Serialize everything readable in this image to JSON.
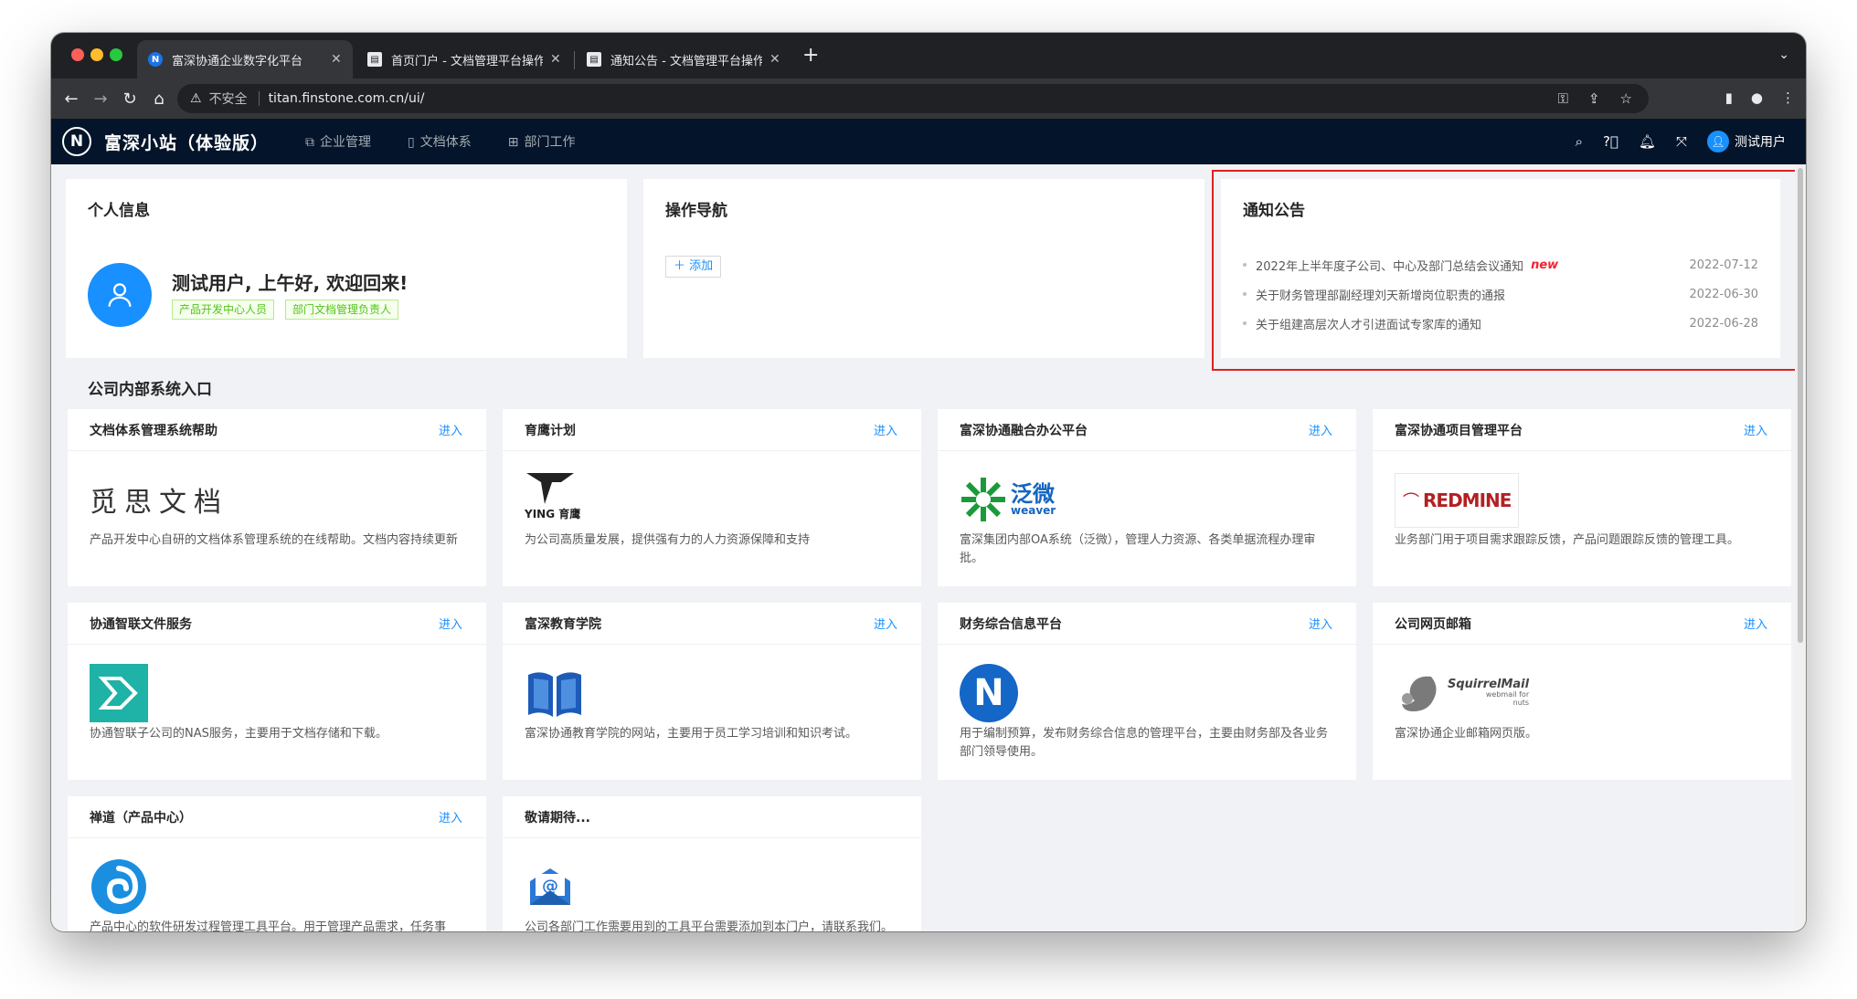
{
  "browser": {
    "tabs": [
      {
        "title": "富深协通企业数字化平台",
        "favicon": "N",
        "active": true
      },
      {
        "title": "首页门户 - 文档管理平台操作指南",
        "favicon": "doc",
        "active": false
      },
      {
        "title": "通知公告 - 文档管理平台操作指南",
        "favicon": "doc",
        "active": false
      }
    ],
    "address": {
      "security_label": "不安全",
      "url": "titan.finstone.com.cn/ui/"
    }
  },
  "app": {
    "logo_letter": "N",
    "title": "富深小站（体验版）",
    "nav": [
      {
        "label": "企业管理",
        "icon": "cluster-icon"
      },
      {
        "label": "文档体系",
        "icon": "file-icon"
      },
      {
        "label": "部门工作",
        "icon": "appstore-icon"
      }
    ],
    "user_name": "测试用户"
  },
  "profile": {
    "title": "个人信息",
    "greeting": "测试用户, 上午好, 欢迎回来!",
    "tags": [
      "产品开发中心人员",
      "部门文档管理负责人"
    ]
  },
  "operations": {
    "title": "操作导航",
    "add_label": "添加"
  },
  "notices": {
    "title": "通知公告",
    "items": [
      {
        "text": "2022年上半年度子公司、中心及部门总结会议通知",
        "badge": "new",
        "date": "2022-07-12"
      },
      {
        "text": "关于财务管理部副经理刘天新增岗位职责的通报",
        "badge": "",
        "date": "2022-06-30"
      },
      {
        "text": "关于组建高层次人才引进面试专家库的通知",
        "badge": "",
        "date": "2022-06-28"
      }
    ]
  },
  "systems": {
    "title": "公司内部系统入口",
    "enter_label": "进入",
    "items": [
      {
        "name": "文档体系管理系统帮助",
        "logo_text": "觅思文档",
        "desc": "产品开发中心自研的文档体系管理系统的在线帮助。文档内容持续更新"
      },
      {
        "name": "育鹰计划",
        "logo_text": "YING 育鹰",
        "desc": "为公司高质量发展，提供强有力的人力资源保障和支持"
      },
      {
        "name": "富深协通融合办公平台",
        "logo_text": "泛微",
        "logo_sub": "weaver",
        "desc": "富深集团内部OA系统（泛微），管理人力资源、各类单据流程办理审批。"
      },
      {
        "name": "富深协通项目管理平台",
        "logo_text": "REDMINE",
        "desc": "业务部门用于项目需求跟踪反馈，产品问题跟踪反馈的管理工具。"
      },
      {
        "name": "协通智联文件服务",
        "logo_text": "",
        "desc": "协通智联子公司的NAS服务，主要用于文档存储和下载。"
      },
      {
        "name": "富深教育学院",
        "logo_text": "",
        "desc": "富深协通教育学院的网站，主要用于员工学习培训和知识考试。"
      },
      {
        "name": "财务综合信息平台",
        "logo_text": "N",
        "desc": "用于编制预算，发布财务综合信息的管理平台，主要由财务部及各业务部门领导使用。"
      },
      {
        "name": "公司网页邮箱",
        "logo_text": "SquirrelMail",
        "logo_sub": "webmail for nuts",
        "desc": "富深协通企业邮箱网页版。"
      },
      {
        "name": "禅道（产品中心）",
        "logo_text": "",
        "desc": "产品中心的软件研发过程管理工具平台。用于管理产品需求，任务事件，功能测试等过程。"
      },
      {
        "name": "敬请期待...",
        "logo_text": "",
        "desc": "公司各部门工作需要用到的工具平台需要添加到本门户，请联系我们。"
      }
    ]
  },
  "colors": {
    "app_header": "#04142a",
    "accent": "#1890ff",
    "highlight": "#e02020",
    "tag_green": "#52c41a",
    "new_badge": "#f5222d"
  }
}
